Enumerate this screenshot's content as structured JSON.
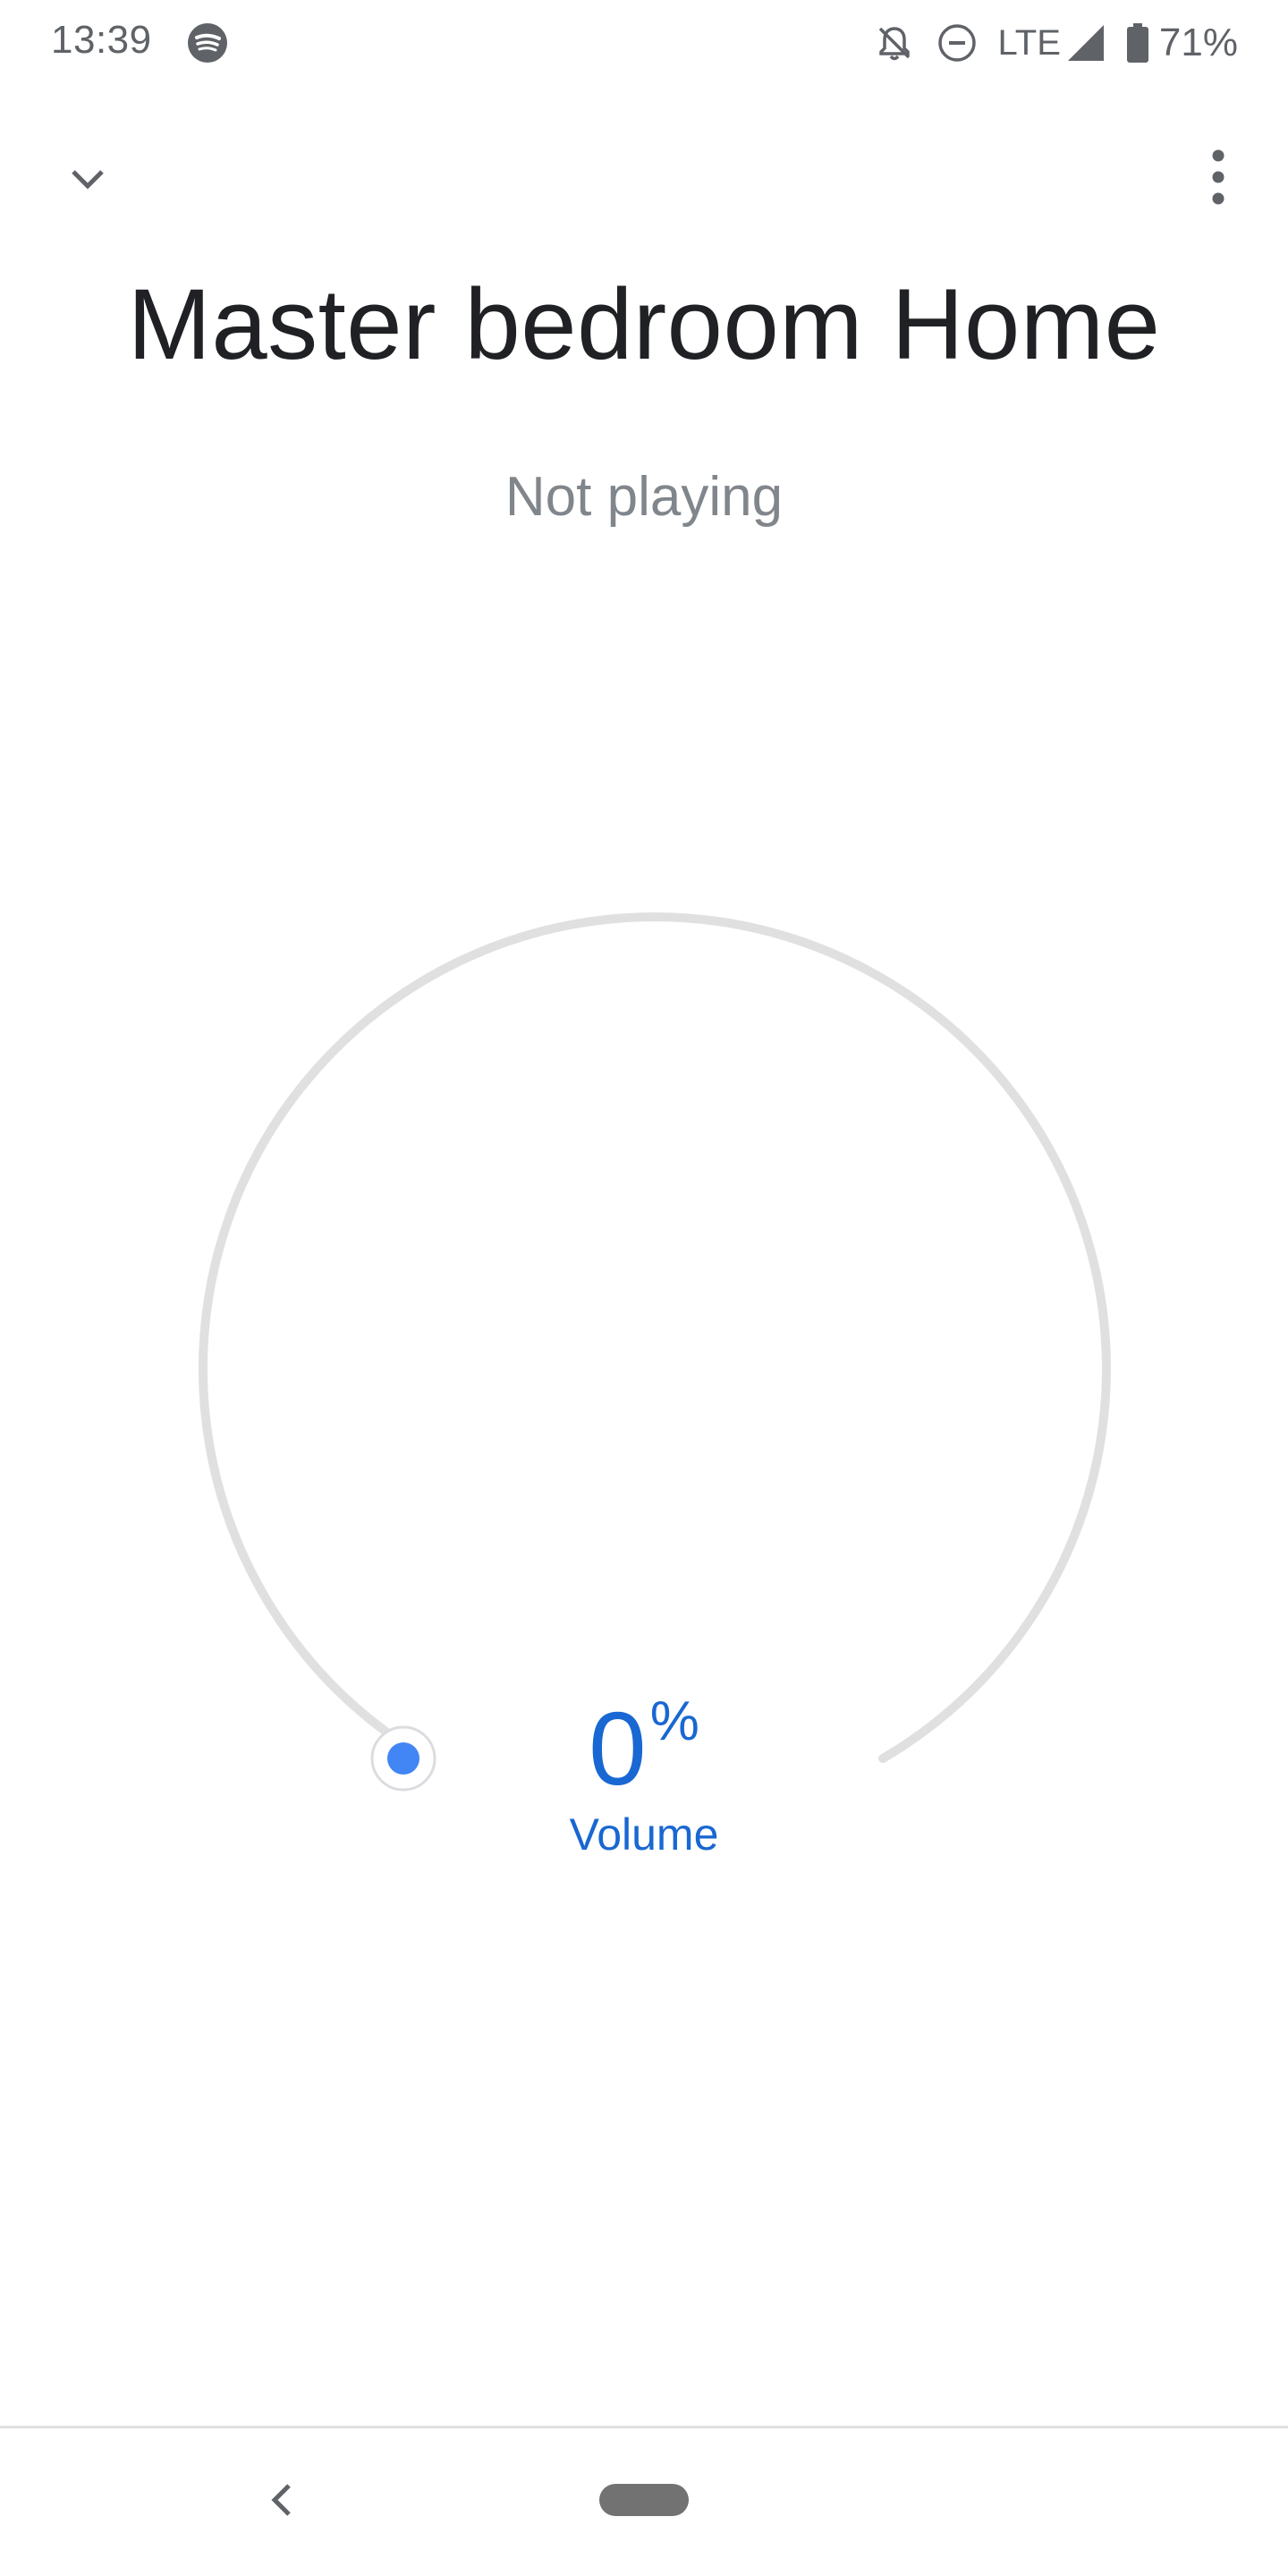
{
  "status_bar": {
    "time": "13:39",
    "network": "LTE",
    "battery": "71%",
    "icons": [
      "spotify-icon",
      "notifications-off-icon",
      "do-not-disturb-icon",
      "signal-icon",
      "battery-icon"
    ]
  },
  "header": {
    "icons": [
      "chevron-down-icon",
      "more-vert-icon"
    ]
  },
  "device": {
    "title": "Master bedroom Home",
    "status": "Not playing"
  },
  "volume": {
    "value": "0",
    "unit": "%",
    "label": "Volume",
    "level_percent": 0
  },
  "nav_bar": {
    "icons": [
      "back-icon",
      "home-pill"
    ]
  },
  "colors": {
    "accent": "#1967d2",
    "knob": "#4285f4",
    "track": "#e0e0e0",
    "title": "#202124",
    "secondary_text": "#80868b"
  }
}
